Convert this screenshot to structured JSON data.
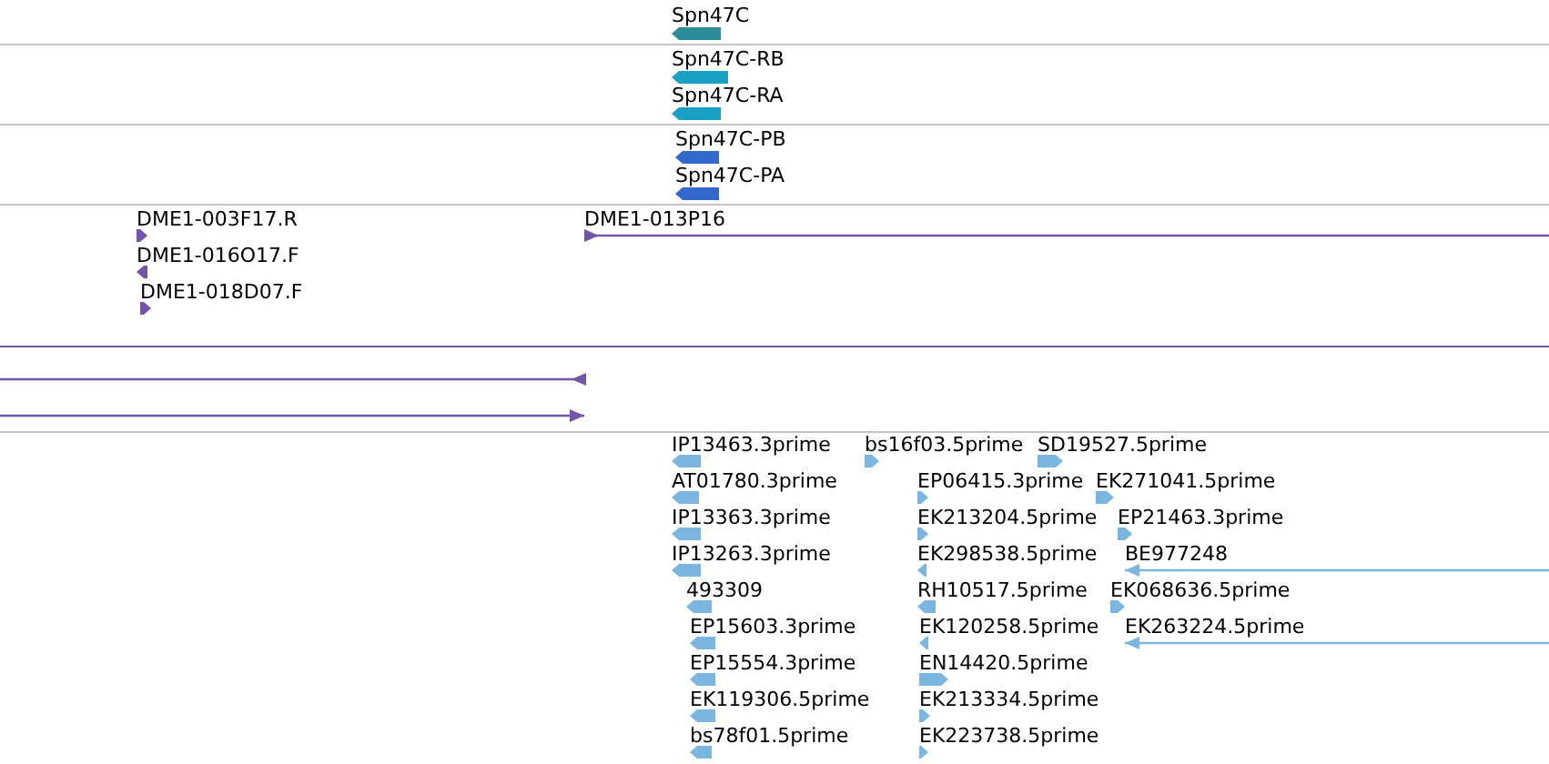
{
  "tracks": [
    {
      "color": "#2e8b99",
      "features": [
        {
          "label": "Spn47C",
          "reverse": true,
          "continues": false
        }
      ]
    },
    {
      "color": "#19a0c4",
      "features": [
        {
          "label": "Spn47C-RB",
          "reverse": true,
          "continues": false
        },
        {
          "label": "Spn47C-RA",
          "reverse": true,
          "continues": false
        }
      ]
    },
    {
      "color": "#3468cc",
      "features": [
        {
          "label": "Spn47C-PB",
          "reverse": true,
          "continues": false
        },
        {
          "label": "Spn47C-PA",
          "reverse": true,
          "continues": false
        }
      ]
    },
    {
      "color": "#7055a8",
      "features": [
        {
          "label": "DME1-003F17.R",
          "reverse": false,
          "continues": false
        },
        {
          "label": "DME1-016O17.F",
          "reverse": true,
          "continues": false
        },
        {
          "label": "DME1-018D07.F",
          "reverse": false,
          "continues": false
        },
        {
          "label": "DME1-013P16",
          "reverse": false,
          "continues": true
        },
        {
          "reverse": true,
          "continues": true
        },
        {
          "reverse": false,
          "continues": true
        }
      ]
    },
    {
      "color": "#7ab6e0",
      "features": [
        {
          "label": "IP13463.3prime",
          "reverse": true,
          "continues": false
        },
        {
          "label": "AT01780.3prime",
          "reverse": true,
          "continues": false
        },
        {
          "label": "IP13363.3prime",
          "reverse": true,
          "continues": false
        },
        {
          "label": "IP13263.3prime",
          "reverse": true,
          "continues": false
        },
        {
          "label": "493309",
          "reverse": true,
          "continues": false
        },
        {
          "label": "EP15603.3prime",
          "reverse": true,
          "continues": false
        },
        {
          "label": "EP15554.3prime",
          "reverse": true,
          "continues": false
        },
        {
          "label": "EK119306.5prime",
          "reverse": true,
          "continues": false
        },
        {
          "label": "bs78f01.5prime",
          "reverse": true,
          "continues": false
        },
        {
          "label": "bs16f03.5prime",
          "reverse": false,
          "continues": false
        },
        {
          "label": "EP06415.3prime",
          "reverse": false,
          "continues": false
        },
        {
          "label": "EK213204.5prime",
          "reverse": false,
          "continues": false
        },
        {
          "label": "EK298538.5prime",
          "reverse": true,
          "continues": false
        },
        {
          "label": "RH10517.5prime",
          "reverse": true,
          "continues": false
        },
        {
          "label": "EK120258.5prime",
          "reverse": true,
          "continues": false
        },
        {
          "label": "EN14420.5prime",
          "reverse": false,
          "continues": false
        },
        {
          "label": "EK213334.5prime",
          "reverse": false,
          "continues": false
        },
        {
          "label": "EK223738.5prime",
          "reverse": false,
          "continues": false
        },
        {
          "label": "SD19527.5prime",
          "reverse": false,
          "continues": false
        },
        {
          "label": "EK271041.5prime",
          "reverse": false,
          "continues": false
        },
        {
          "label": "EP21463.3prime",
          "reverse": false,
          "continues": false
        },
        {
          "label": "BE977248",
          "reverse": true,
          "continues": true
        },
        {
          "label": "EK068636.5prime",
          "reverse": false,
          "continues": false
        },
        {
          "label": "EK263224.5prime",
          "reverse": true,
          "continues": true
        }
      ]
    }
  ]
}
